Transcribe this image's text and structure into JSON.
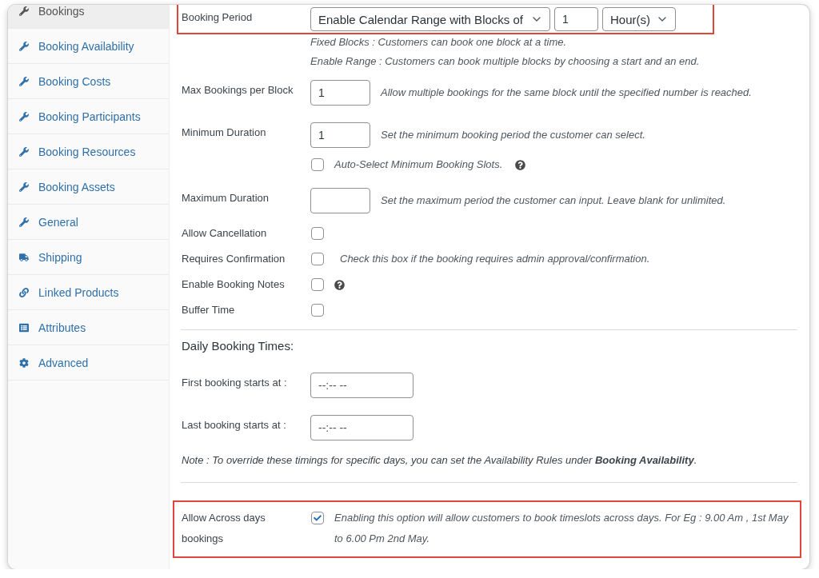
{
  "sidebar": {
    "items": [
      {
        "label": "Bookings",
        "kind": "tool",
        "selected": true
      },
      {
        "label": "Booking Availability",
        "kind": "tool",
        "selected": false
      },
      {
        "label": "Booking Costs",
        "kind": "tool",
        "selected": false
      },
      {
        "label": "Booking Participants",
        "kind": "tool",
        "selected": false
      },
      {
        "label": "Booking Resources",
        "kind": "tool",
        "selected": false
      },
      {
        "label": "Booking Assets",
        "kind": "tool",
        "selected": false
      },
      {
        "label": "General",
        "kind": "tool",
        "selected": false
      },
      {
        "label": "Shipping",
        "kind": "shipping",
        "selected": false
      },
      {
        "label": "Linked Products",
        "kind": "link",
        "selected": false
      },
      {
        "label": "Attributes",
        "kind": "attributes",
        "selected": false
      },
      {
        "label": "Advanced",
        "kind": "advanced",
        "selected": false
      }
    ]
  },
  "booking_period": {
    "label": "Booking Period",
    "highlighted": true,
    "type": "Enable Calendar Range with Blocks of",
    "block_length": "1",
    "unit": "Hour(s)",
    "notes": [
      "Fixed Blocks : Customers can book one block at a time.",
      "Enable Range : Customers can book multiple blocks by choosing a start and an end."
    ]
  },
  "fields": [
    {
      "kind": "number",
      "label": "Max Bookings per Block",
      "value": "1",
      "help": "Allow multiple bookings for the same block until the specified number is reached."
    },
    {
      "kind": "number",
      "label": "Minimum Duration",
      "value": "1",
      "help": "Set the minimum booking period the customer can select."
    },
    {
      "kind": "option",
      "text": "Auto-Select Minimum Booking Slots.",
      "checked": false,
      "tip": true
    },
    {
      "kind": "number",
      "label": "Maximum Duration",
      "help": "Set the maximum period the customer can input. Leave blank for unlimited."
    },
    {
      "kind": "checkbox",
      "label": "Allow Cancellation",
      "checked": false
    },
    {
      "kind": "checkbox",
      "label": "Requires Confirmation",
      "checked": false,
      "help": "Check this box if the booking requires admin approval/confirmation."
    },
    {
      "kind": "checkbox",
      "label": "Enable Booking Notes",
      "checked": false,
      "tip": true
    },
    {
      "kind": "checkbox",
      "label": "Buffer Time",
      "checked": false
    }
  ],
  "daily_booking_times": {
    "title": "Daily Booking Times:",
    "fields": [
      {
        "label": "First booking starts at :",
        "placeholder": "--:-- --"
      },
      {
        "label": "Last booking starts at :",
        "placeholder": "--:-- --"
      }
    ],
    "note": "Note : To override these timings for specific days, you can set the Availability Rules under **Booking Availability**."
  },
  "across_days": {
    "label": "Allow Across days bookings",
    "highlighted": true,
    "checked": true,
    "description": "Enabling this option will allow customers to book timeslots across days. For Eg : 9.00 Am , 1st May to 6.00 Pm 2nd May."
  }
}
